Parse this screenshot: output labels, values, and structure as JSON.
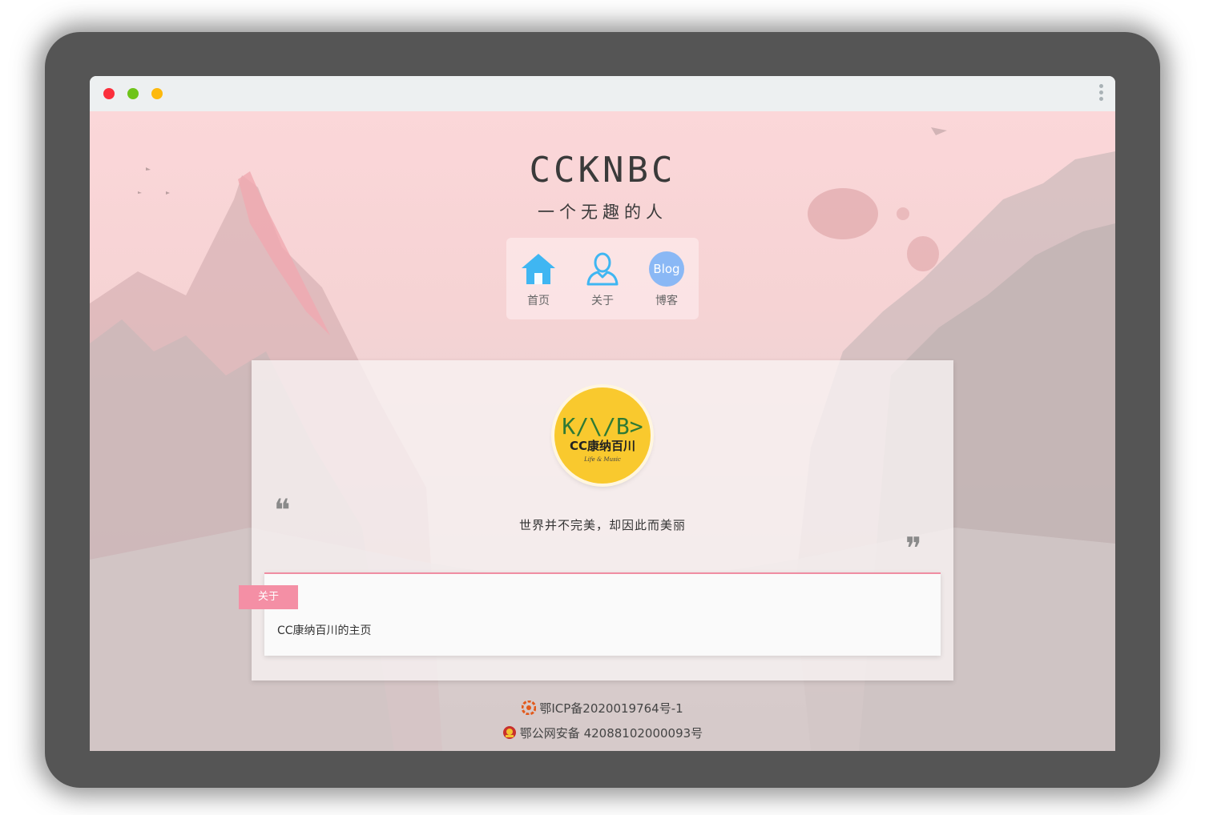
{
  "window": {
    "buttons": [
      "close",
      "minimize",
      "maximize"
    ],
    "menu_icon": "more-vertical-icon"
  },
  "header": {
    "title": "CCKNBC",
    "subtitle": "一个无趣的人"
  },
  "nav": {
    "items": [
      {
        "label": "首页",
        "icon": "home-icon",
        "color": "#3fb6f2"
      },
      {
        "label": "关于",
        "icon": "user-icon",
        "color": "#3fb6f2"
      },
      {
        "label": "博客",
        "icon": "blog-icon",
        "icon_text": "Blog",
        "color": "#8ab8f5"
      }
    ]
  },
  "profile": {
    "avatar": {
      "logo_text": "K/\\/B>",
      "logo_sub": "CC康纳百川",
      "logo_tag": "Life & Music"
    },
    "motto": "世界并不完美，却因此而美丽"
  },
  "about": {
    "tag": "关于",
    "text": "CC康纳百川的主页"
  },
  "footer": {
    "icp": "鄂ICP备2020019764号-1",
    "police": "鄂公网安备 42088102000093号"
  },
  "colors": {
    "accent_pink": "#f48fa5",
    "nav_blue": "#3fb6f2",
    "avatar_yellow": "#f9c92e"
  }
}
